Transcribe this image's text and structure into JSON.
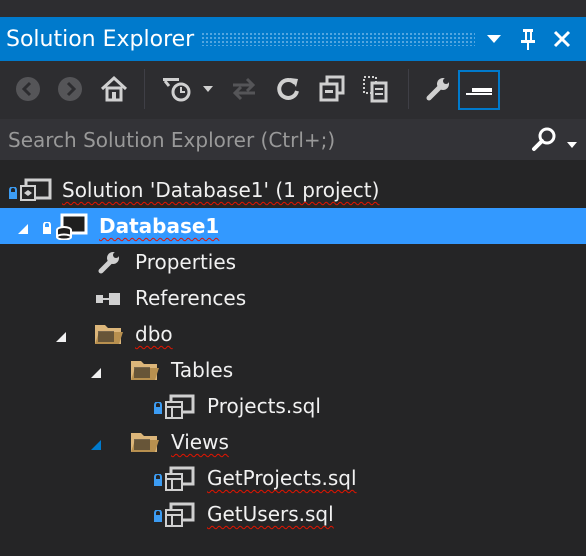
{
  "window": {
    "title": "Solution Explorer",
    "controls": [
      "dropdown-icon",
      "pin-icon",
      "close-icon"
    ]
  },
  "toolbar": {
    "buttons": [
      "back-icon",
      "forward-icon",
      "home-icon",
      "pending-changes-filter-icon",
      "sync-icon",
      "refresh-icon",
      "collapse-all-icon",
      "show-all-files-icon",
      "properties-icon",
      "preview-selected-items-icon"
    ]
  },
  "search": {
    "placeholder": "Search Solution Explorer (Ctrl+;)"
  },
  "tree": {
    "solution": "Solution 'Database1' (1 project)",
    "project": "Database1",
    "properties": "Properties",
    "references": "References",
    "dbo": "dbo",
    "tables": "Tables",
    "projects_sql": "Projects.sql",
    "views": "Views",
    "getprojects_sql": "GetProjects.sql",
    "getusers_sql": "GetUsers.sql"
  },
  "colors": {
    "accent": "#007acc",
    "selection": "#3399ff",
    "background": "#252526",
    "squiggle": "#e51400",
    "folder": "#dcb67a",
    "lock": "#3c9cf3"
  }
}
